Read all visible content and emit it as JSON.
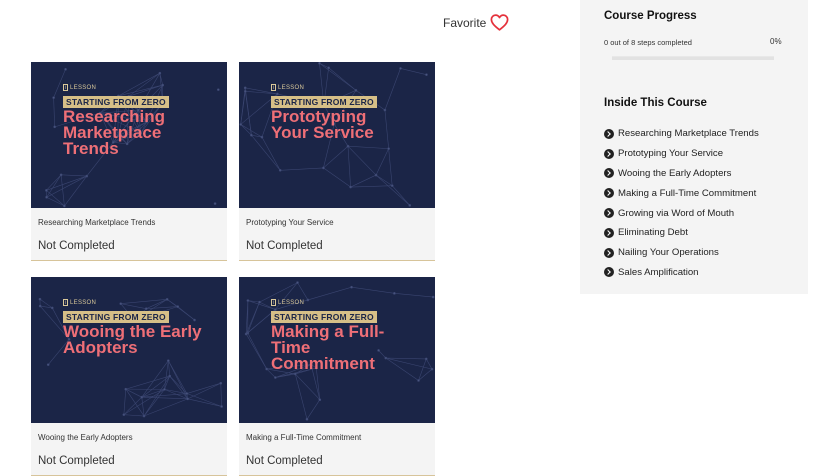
{
  "favorite": {
    "label": "Favorite",
    "icon": "heart-icon",
    "color": "#e5323c"
  },
  "lessons": [
    {
      "tag": "LESSON",
      "series": "STARTING FROM ZERO",
      "title_lines": [
        "Researching",
        "Marketplace",
        "Trends"
      ],
      "title": "Researching Marketplace Trends",
      "status": "Not Completed"
    },
    {
      "tag": "LESSON",
      "series": "STARTING FROM ZERO",
      "title_lines": [
        "Prototyping",
        "Your Service"
      ],
      "title": "Prototyping Your Service",
      "status": "Not Completed"
    },
    {
      "tag": "LESSON",
      "series": "STARTING FROM ZERO",
      "title_lines": [
        "Wooing the Early",
        "Adopters"
      ],
      "title": "Wooing the Early Adopters",
      "status": "Not Completed"
    },
    {
      "tag": "LESSON",
      "series": "STARTING FROM ZERO",
      "title_lines": [
        "Making a Full-",
        "Time",
        "Commitment"
      ],
      "title": "Making a Full-Time Commitment",
      "status": "Not Completed"
    }
  ],
  "sidebar": {
    "progress_heading": "Course Progress",
    "steps_text": "0 out of 8 steps completed",
    "percent_text": "0%",
    "progress_fraction": 0,
    "inside_heading": "Inside This Course",
    "items": [
      "Researching Marketplace Trends",
      "Prototyping Your Service",
      "Wooing the Early Adopters",
      "Making a Full-Time Commitment",
      "Growing via Word of Mouth",
      "Eliminating Debt",
      "Nailing Your Operations",
      "Sales Amplification"
    ]
  },
  "colors": {
    "thumb_bg": "#1b2547",
    "title_pink": "#ee6f77",
    "badge_gold": "#d6bf87"
  }
}
